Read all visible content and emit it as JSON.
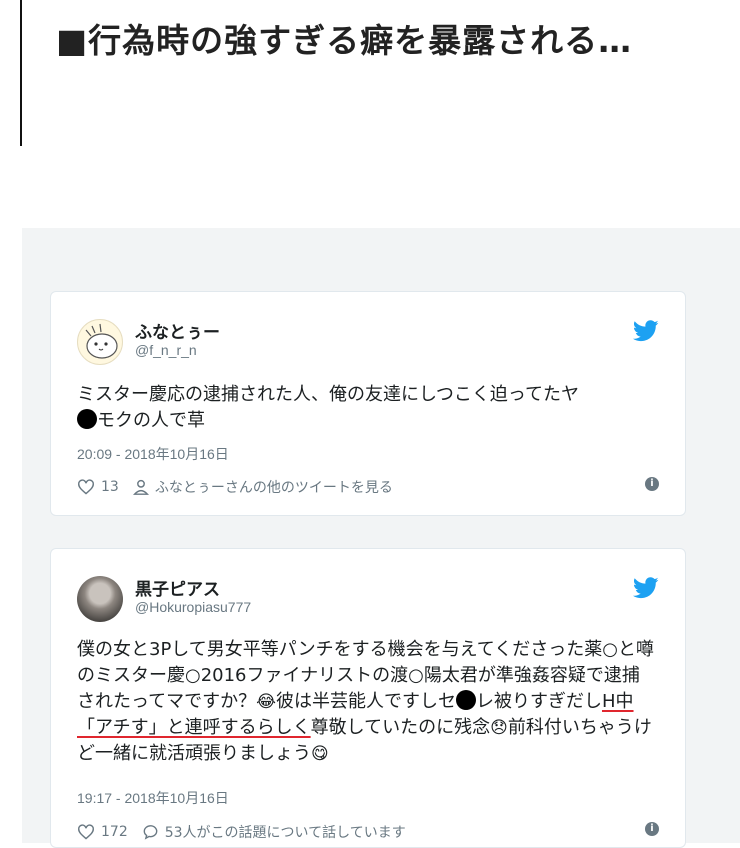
{
  "article": {
    "headline": "■行為時の強すぎる癖を暴露される…"
  },
  "tweets": [
    {
      "name": "ふなとぅー",
      "handle": "@f_n_r_n",
      "text_a": "ミスター慶応の逮捕された人、俺の友達にしつこく迫ってたヤ",
      "text_b": "モクの人で草",
      "time": "20:09 - 2018年10月16日",
      "likes": "13",
      "secondary_action": "ふなとぅーさんの他のツイートを見る"
    },
    {
      "name": "黒子ピアス",
      "handle": "@Hokuropiasu777",
      "text_a": "僕の女と3Pして男女平等パンチをする機会を与えてくださった薬○と噂のミスター慶○2016ファイナリストの渡○陽太君が準強姦容疑で逮捕されたってマですか？",
      "emoji_a": "😂",
      "text_b": "彼は半芸能人ですしセ",
      "text_c": "レ被りすぎだし",
      "text_underlined": "H中「アチす」と連呼するらしく",
      "text_d": "尊敬していたのに残念",
      "emoji_b": "😞",
      "text_e": "前科付いちゃうけど一緒に就活頑張りましょう",
      "emoji_c": "😋",
      "time": "19:17 - 2018年10月16日",
      "likes": "172",
      "replies": "53人がこの話題について話しています"
    }
  ],
  "icons": {
    "bird": "twitter-bird-icon",
    "heart": "heart-icon",
    "person": "person-icon",
    "reply": "reply-bubble-icon",
    "info": "info-icon"
  },
  "colors": {
    "twitter_blue": "#1da1f2",
    "meta_gray": "#697882",
    "underline_red": "#e0262e"
  }
}
